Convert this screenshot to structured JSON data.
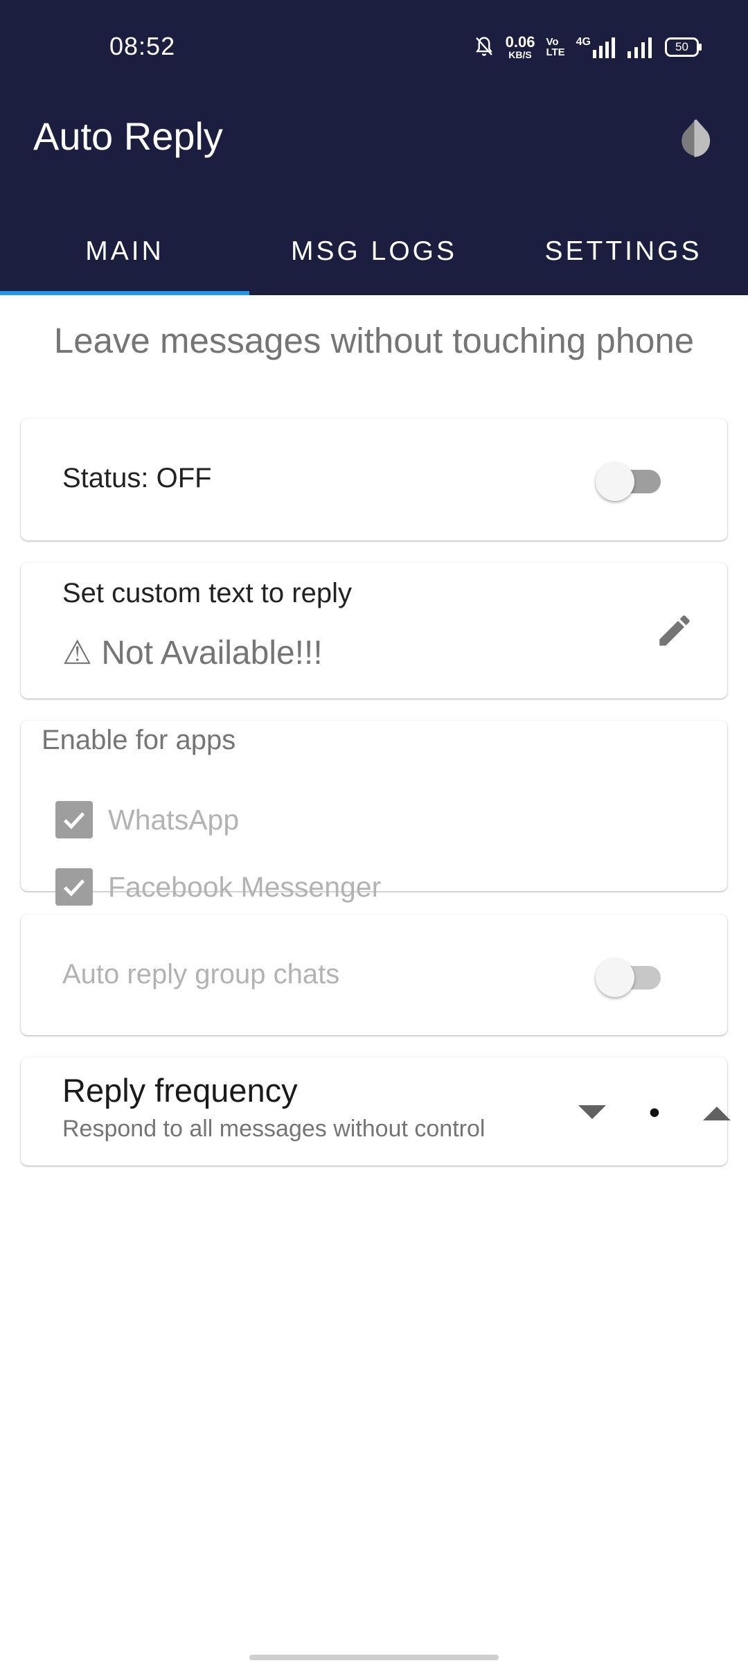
{
  "status_bar": {
    "time": "08:52",
    "net_speed_value": "0.06",
    "net_speed_unit": "KB/S",
    "volte_top": "Vo",
    "volte_bottom": "LTE",
    "network": "4G",
    "battery": "50",
    "icons": [
      "bell-off-icon",
      "network-speed",
      "volte-icon",
      "4g-signal-icon",
      "signal-icon",
      "battery-icon"
    ]
  },
  "app_bar": {
    "title": "Auto Reply",
    "theme_icon": "invert-colors-icon"
  },
  "tabs": [
    {
      "label": "MAIN",
      "active": true
    },
    {
      "label": "MSG LOGS",
      "active": false
    },
    {
      "label": "SETTINGS",
      "active": false
    }
  ],
  "main": {
    "subtitle": "Leave messages without touching phone",
    "status": {
      "label": "Status: OFF",
      "enabled": false
    },
    "custom_text": {
      "title": "Set custom text to reply",
      "value": "⚠ Not Available!!!",
      "icon": "pencil-icon"
    },
    "apps": {
      "title": "Enable for apps",
      "items": [
        {
          "label": "WhatsApp",
          "checked": true
        },
        {
          "label": "Facebook Messenger",
          "checked": true
        }
      ]
    },
    "group_chats": {
      "label": "Auto reply group chats",
      "enabled": false
    },
    "reply_frequency": {
      "title": "Reply frequency",
      "description": "Respond to all messages without control",
      "value": "•"
    }
  },
  "colors": {
    "header_bg": "#1b1e3e",
    "tab_indicator": "#2196f3",
    "disabled_text": "#b3b3b3",
    "secondary_text": "#757575"
  }
}
